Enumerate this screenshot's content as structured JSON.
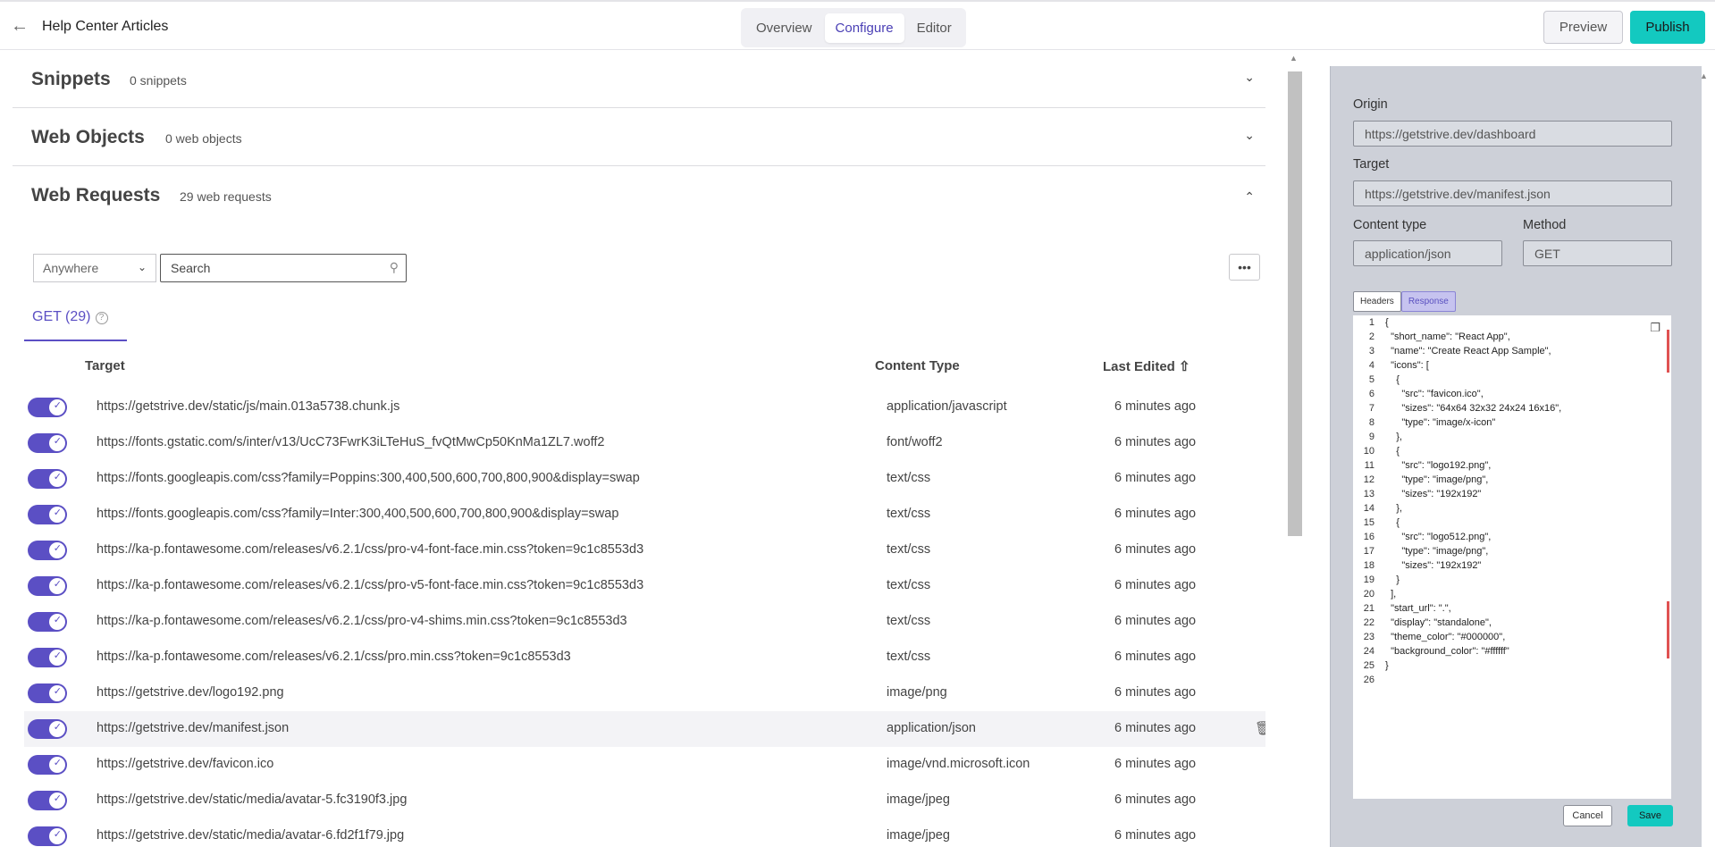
{
  "header": {
    "back_icon": "arrow-left-icon",
    "title": "Help Center Articles",
    "tabs": [
      {
        "label": "Overview",
        "active": false
      },
      {
        "label": "Configure",
        "active": true
      },
      {
        "label": "Editor",
        "active": false
      }
    ],
    "preview_label": "Preview",
    "publish_label": "Publish",
    "accent_color": "#13c9c0"
  },
  "sections": [
    {
      "title": "Snippets",
      "count": "0 snippets",
      "expanded": false
    },
    {
      "title": "Web Objects",
      "count": "0 web objects",
      "expanded": false
    },
    {
      "title": "Web Requests",
      "count": "29 web requests",
      "expanded": true
    }
  ],
  "filters": {
    "scope_value": "Anywhere",
    "search_placeholder": "Search"
  },
  "method_tab": {
    "label": "GET (29)"
  },
  "table": {
    "columns": {
      "target": "Target",
      "content_type": "Content Type",
      "last_edited": "Last Edited"
    },
    "sort_icon": "arrow-up-icon",
    "rows": [
      {
        "target": "https://getstrive.dev/static/js/main.013a5738.chunk.js",
        "content_type": "application/javascript",
        "last_edited": "6 minutes ago",
        "enabled": true
      },
      {
        "target": "https://fonts.gstatic.com/s/inter/v13/UcC73FwrK3iLTeHuS_fvQtMwCp50KnMa1ZL7.woff2",
        "content_type": "font/woff2",
        "last_edited": "6 minutes ago",
        "enabled": true
      },
      {
        "target": "https://fonts.googleapis.com/css?family=Poppins:300,400,500,600,700,800,900&display=swap",
        "content_type": "text/css",
        "last_edited": "6 minutes ago",
        "enabled": true
      },
      {
        "target": "https://fonts.googleapis.com/css?family=Inter:300,400,500,600,700,800,900&display=swap",
        "content_type": "text/css",
        "last_edited": "6 minutes ago",
        "enabled": true
      },
      {
        "target": "https://ka-p.fontawesome.com/releases/v6.2.1/css/pro-v4-font-face.min.css?token=9c1c8553d3",
        "content_type": "text/css",
        "last_edited": "6 minutes ago",
        "enabled": true
      },
      {
        "target": "https://ka-p.fontawesome.com/releases/v6.2.1/css/pro-v5-font-face.min.css?token=9c1c8553d3",
        "content_type": "text/css",
        "last_edited": "6 minutes ago",
        "enabled": true
      },
      {
        "target": "https://ka-p.fontawesome.com/releases/v6.2.1/css/pro-v4-shims.min.css?token=9c1c8553d3",
        "content_type": "text/css",
        "last_edited": "6 minutes ago",
        "enabled": true
      },
      {
        "target": "https://ka-p.fontawesome.com/releases/v6.2.1/css/pro.min.css?token=9c1c8553d3",
        "content_type": "text/css",
        "last_edited": "6 minutes ago",
        "enabled": true
      },
      {
        "target": "https://getstrive.dev/logo192.png",
        "content_type": "image/png",
        "last_edited": "6 minutes ago",
        "enabled": true
      },
      {
        "target": "https://getstrive.dev/manifest.json",
        "content_type": "application/json",
        "last_edited": "6 minutes ago",
        "enabled": true,
        "selected": true
      },
      {
        "target": "https://getstrive.dev/favicon.ico",
        "content_type": "image/vnd.microsoft.icon",
        "last_edited": "6 minutes ago",
        "enabled": true
      },
      {
        "target": "https://getstrive.dev/static/media/avatar-5.fc3190f3.jpg",
        "content_type": "image/jpeg",
        "last_edited": "6 minutes ago",
        "enabled": true
      },
      {
        "target": "https://getstrive.dev/static/media/avatar-6.fd2f1f79.jpg",
        "content_type": "image/jpeg",
        "last_edited": "6 minutes ago",
        "enabled": true
      }
    ]
  },
  "detail": {
    "origin_label": "Origin",
    "origin_value": "https://getstrive.dev/dashboard",
    "target_label": "Target",
    "target_value": "https://getstrive.dev/manifest.json",
    "content_type_label": "Content type",
    "content_type_value": "application/json",
    "method_label": "Method",
    "method_value": "GET",
    "tabs": [
      {
        "label": "Headers",
        "active": false
      },
      {
        "label": "Response",
        "active": true
      }
    ],
    "code_lines": [
      "{",
      "  \"short_name\": \"React App\",",
      "  \"name\": \"Create React App Sample\",",
      "  \"icons\": [",
      "    {",
      "      \"src\": \"favicon.ico\",",
      "      \"sizes\": \"64x64 32x32 24x24 16x16\",",
      "      \"type\": \"image/x-icon\"",
      "    },",
      "    {",
      "      \"src\": \"logo192.png\",",
      "      \"type\": \"image/png\",",
      "      \"sizes\": \"192x192\"",
      "    },",
      "    {",
      "      \"src\": \"logo512.png\",",
      "      \"type\": \"image/png\",",
      "      \"sizes\": \"192x192\"",
      "    }",
      "  ],",
      "  \"start_url\": \".\",",
      "  \"display\": \"standalone\",",
      "  \"theme_color\": \"#000000\",",
      "  \"background_color\": \"#ffffff\"",
      "}",
      ""
    ],
    "cancel_label": "Cancel",
    "save_label": "Save"
  }
}
